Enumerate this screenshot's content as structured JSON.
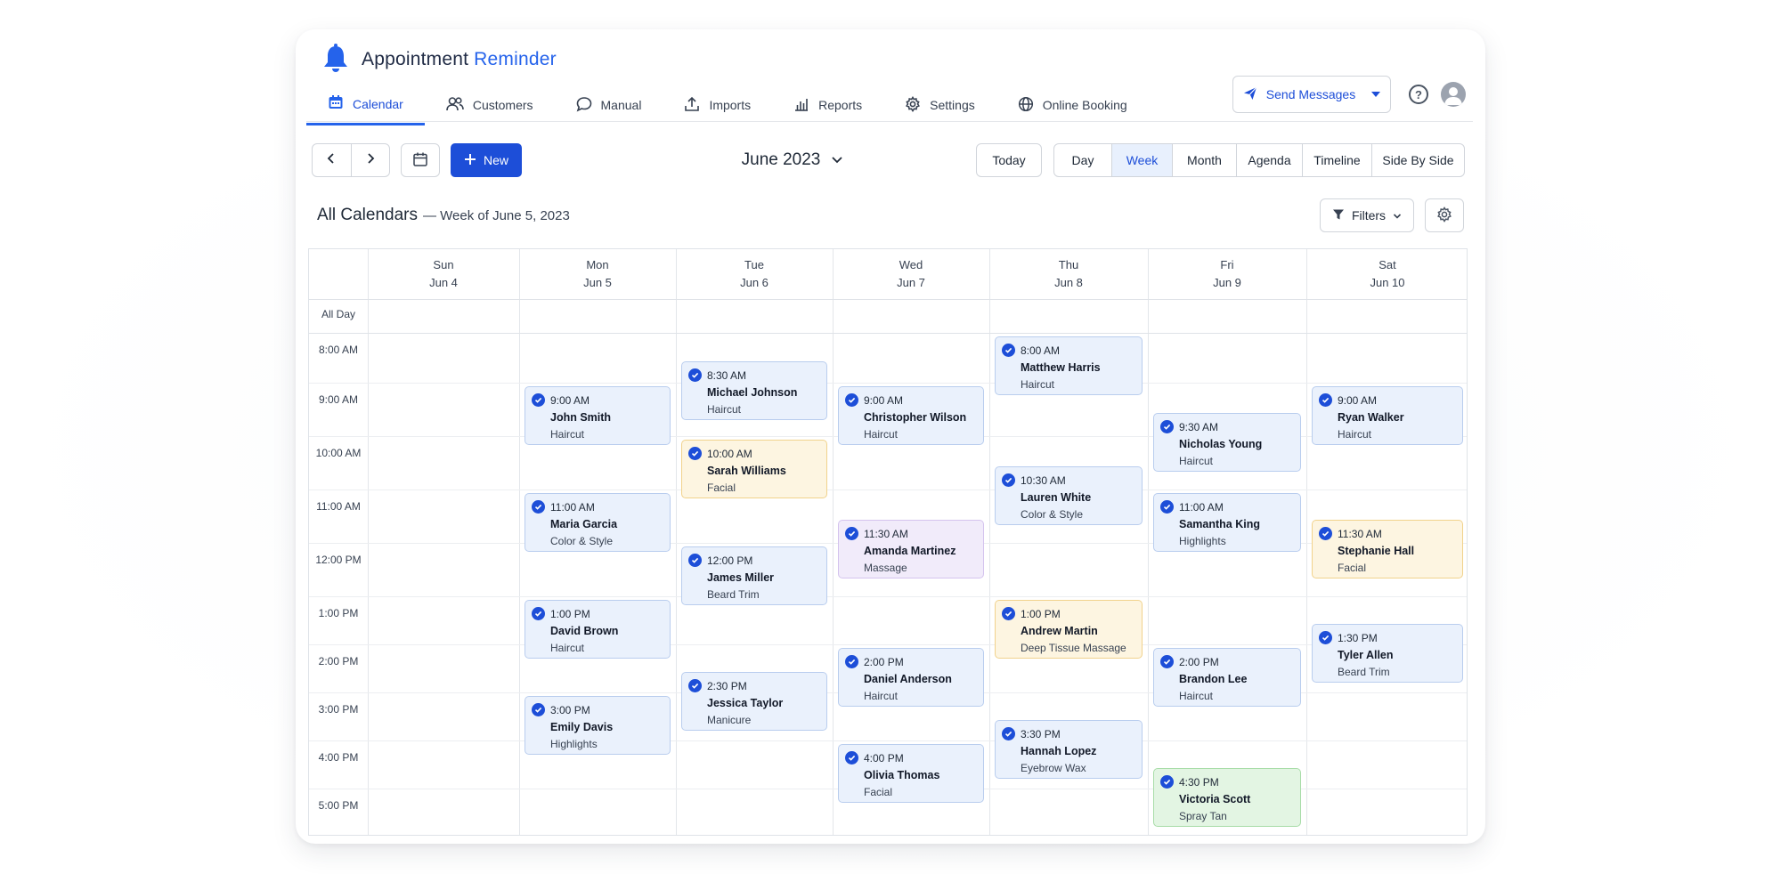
{
  "app": {
    "name": "Appointment",
    "name_accent": "Reminder"
  },
  "nav": [
    {
      "label": "Calendar",
      "icon": "calendar-icon",
      "active": true
    },
    {
      "label": "Customers",
      "icon": "users-icon"
    },
    {
      "label": "Manual",
      "icon": "chat-bubble-icon"
    },
    {
      "label": "Imports",
      "icon": "upload-icon"
    },
    {
      "label": "Reports",
      "icon": "bar-chart-icon"
    },
    {
      "label": "Settings",
      "icon": "gear-icon"
    },
    {
      "label": "Online Booking",
      "icon": "globe-icon"
    }
  ],
  "header": {
    "send_messages": "Send Messages",
    "help": "?"
  },
  "toolbar": {
    "new_label": "New",
    "month": "June 2023",
    "today": "Today",
    "views": [
      "Day",
      "Week",
      "Month",
      "Agenda",
      "Timeline",
      "Side By Side"
    ],
    "active_view": "Week",
    "filters": "Filters"
  },
  "calendar": {
    "title": "All Calendars",
    "subtitle": "— Week of June 5, 2023",
    "all_day_label": "All Day",
    "days": [
      {
        "name": "Sun",
        "date": "Jun 4"
      },
      {
        "name": "Mon",
        "date": "Jun 5"
      },
      {
        "name": "Tue",
        "date": "Jun 6"
      },
      {
        "name": "Wed",
        "date": "Jun 7"
      },
      {
        "name": "Thu",
        "date": "Jun 8"
      },
      {
        "name": "Fri",
        "date": "Jun 9"
      },
      {
        "name": "Sat",
        "date": "Jun 10"
      }
    ],
    "times": [
      "8:00 AM",
      "9:00 AM",
      "10:00 AM",
      "11:00 AM",
      "12:00 PM",
      "1:00 PM",
      "2:00 PM",
      "3:00 PM",
      "4:00 PM",
      "5:00 PM"
    ],
    "events": [
      {
        "day": 1,
        "time": "9:00 AM",
        "name": "John Smith",
        "service": "Haircut",
        "color": "blue"
      },
      {
        "day": 1,
        "time": "11:00 AM",
        "name": "Maria Garcia",
        "service": "Color & Style",
        "color": "blue"
      },
      {
        "day": 1,
        "time": "1:00 PM",
        "name": "David Brown",
        "service": "Haircut",
        "color": "blue"
      },
      {
        "day": 1,
        "time": "3:00 PM",
        "name": "Emily Davis",
        "service": "Highlights",
        "color": "blue"
      },
      {
        "day": 2,
        "time": "8:30 AM",
        "name": "Michael Johnson",
        "service": "Haircut",
        "color": "blue"
      },
      {
        "day": 2,
        "time": "10:00 AM",
        "name": "Sarah Williams",
        "service": "Facial",
        "color": "yellow"
      },
      {
        "day": 2,
        "time": "12:00 PM",
        "name": "James Miller",
        "service": "Beard Trim",
        "color": "blue"
      },
      {
        "day": 2,
        "time": "2:30 PM",
        "name": "Jessica Taylor",
        "service": "Manicure",
        "color": "blue"
      },
      {
        "day": 3,
        "time": "9:00 AM",
        "name": "Christopher Wilson",
        "service": "Haircut",
        "color": "blue"
      },
      {
        "day": 3,
        "time": "11:30 AM",
        "name": "Amanda Martinez",
        "service": "Massage",
        "color": "purple"
      },
      {
        "day": 3,
        "time": "2:00 PM",
        "name": "Daniel Anderson",
        "service": "Haircut",
        "color": "blue"
      },
      {
        "day": 3,
        "time": "4:00 PM",
        "name": "Olivia Thomas",
        "service": "Facial",
        "color": "blue"
      },
      {
        "day": 4,
        "time": "8:00 AM",
        "name": "Matthew Harris",
        "service": "Haircut",
        "color": "blue"
      },
      {
        "day": 4,
        "time": "10:30 AM",
        "name": "Lauren White",
        "service": "Color & Style",
        "color": "blue"
      },
      {
        "day": 4,
        "time": "1:00 PM",
        "name": "Andrew Martin",
        "service": "Deep Tissue Massage",
        "color": "yellow"
      },
      {
        "day": 4,
        "time": "3:30 PM",
        "name": "Hannah Lopez",
        "service": "Eyebrow Wax",
        "color": "blue"
      },
      {
        "day": 5,
        "time": "9:30 AM",
        "name": "Nicholas Young",
        "service": "Haircut",
        "color": "blue"
      },
      {
        "day": 5,
        "time": "11:00 AM",
        "name": "Samantha King",
        "service": "Highlights",
        "color": "blue"
      },
      {
        "day": 5,
        "time": "2:00 PM",
        "name": "Brandon Lee",
        "service": "Haircut",
        "color": "blue"
      },
      {
        "day": 5,
        "time": "4:30 PM",
        "name": "Victoria Scott",
        "service": "Spray Tan",
        "color": "green"
      },
      {
        "day": 6,
        "time": "9:00 AM",
        "name": "Ryan Walker",
        "service": "Haircut",
        "color": "blue"
      },
      {
        "day": 6,
        "time": "11:30 AM",
        "name": "Stephanie Hall",
        "service": "Facial",
        "color": "yellow"
      },
      {
        "day": 6,
        "time": "1:30 PM",
        "name": "Tyler Allen",
        "service": "Beard Trim",
        "color": "blue"
      }
    ]
  }
}
